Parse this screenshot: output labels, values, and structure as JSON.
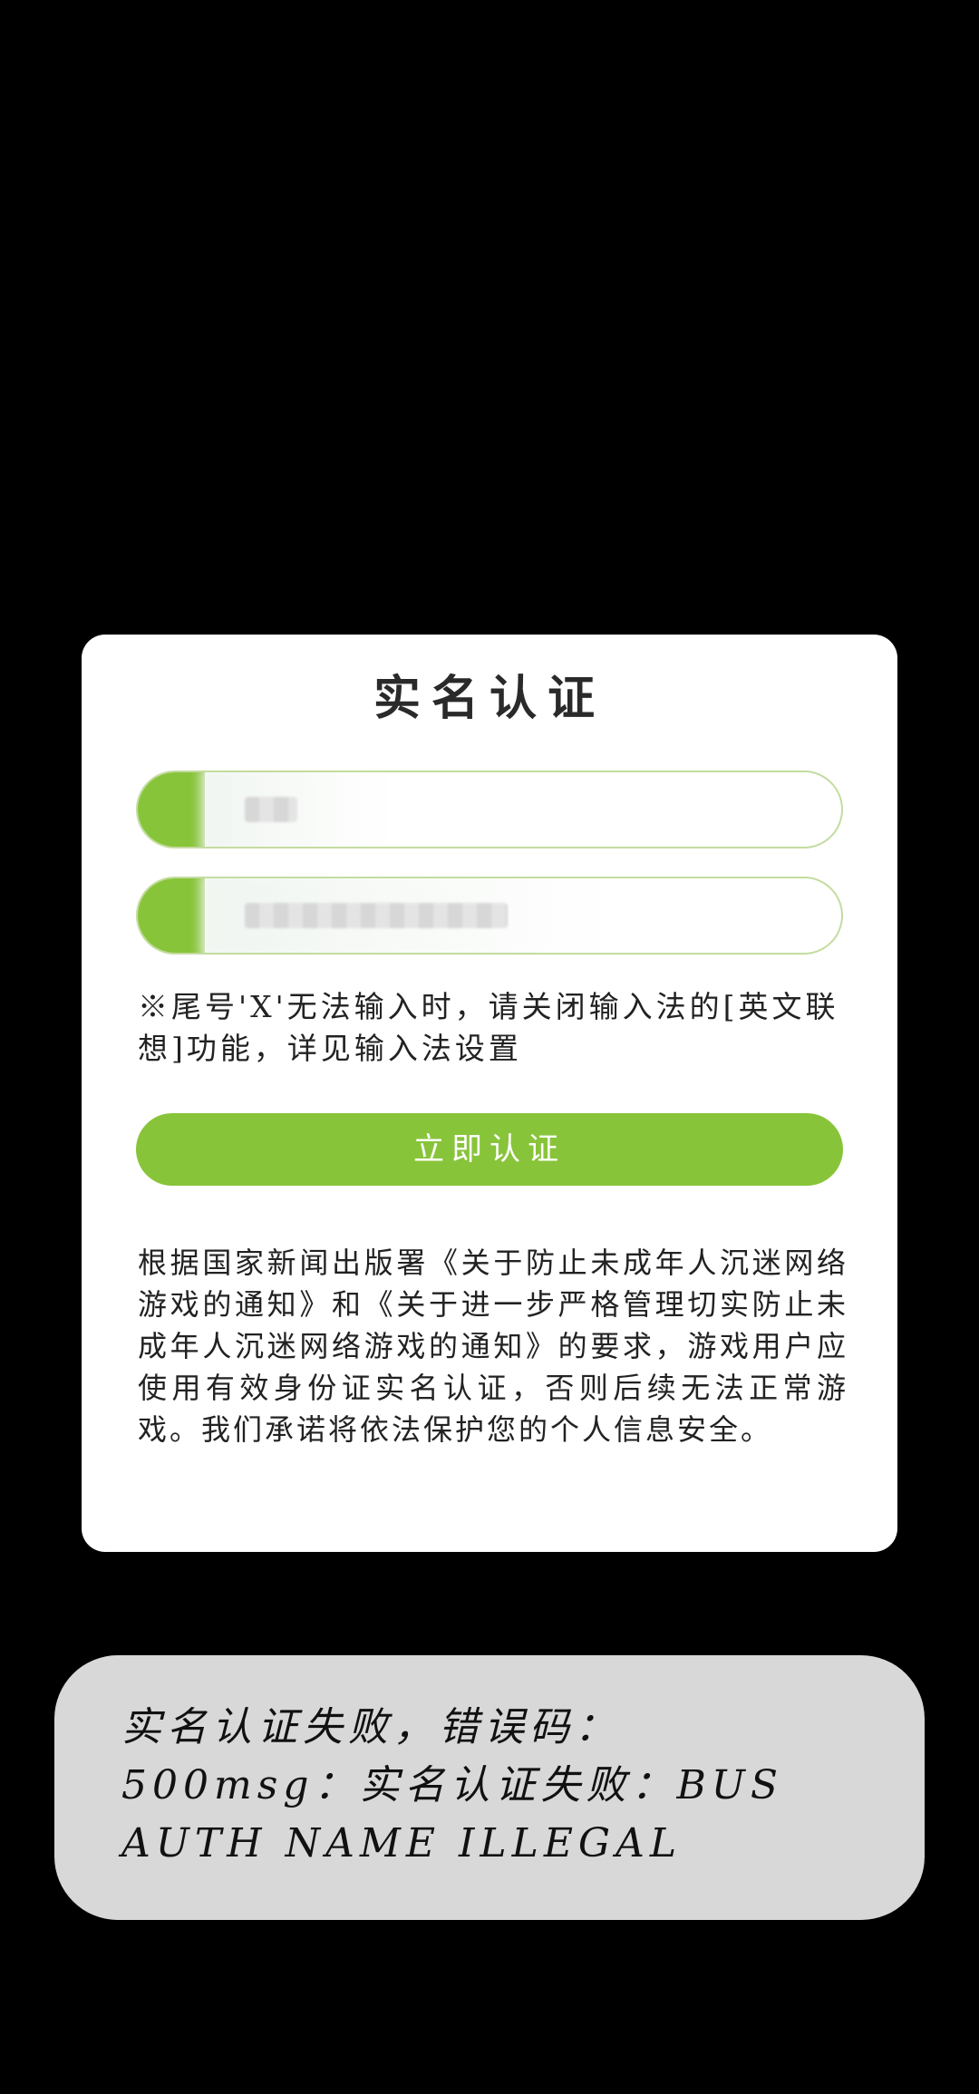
{
  "dialog": {
    "title": "实名认证",
    "name_field": {
      "value": "███"
    },
    "id_field": {
      "value": "██████████████████"
    },
    "hint": "※尾号'X'无法输入时，请关闭输入法的[英文联想]功能，详见输入法设置",
    "submit_label": "立即认证",
    "notice": "根据国家新闻出版署《关于防止未成年人沉迷网络游戏的通知》和《关于进一步严格管理切实防止未成年人沉迷网络游戏的通知》的要求，游戏用户应使用有效身份证实名认证，否则后续无法正常游戏。我们承诺将依法保护您的个人信息安全。"
  },
  "toast": {
    "message": "实名认证失败，错误码：500msg：实名认证失败：BUS AUTH NAME ILLEGAL"
  },
  "colors": {
    "accent": "#88c43a",
    "background": "#000000",
    "dialog": "#ffffff",
    "toast": "#d8d8d8"
  }
}
